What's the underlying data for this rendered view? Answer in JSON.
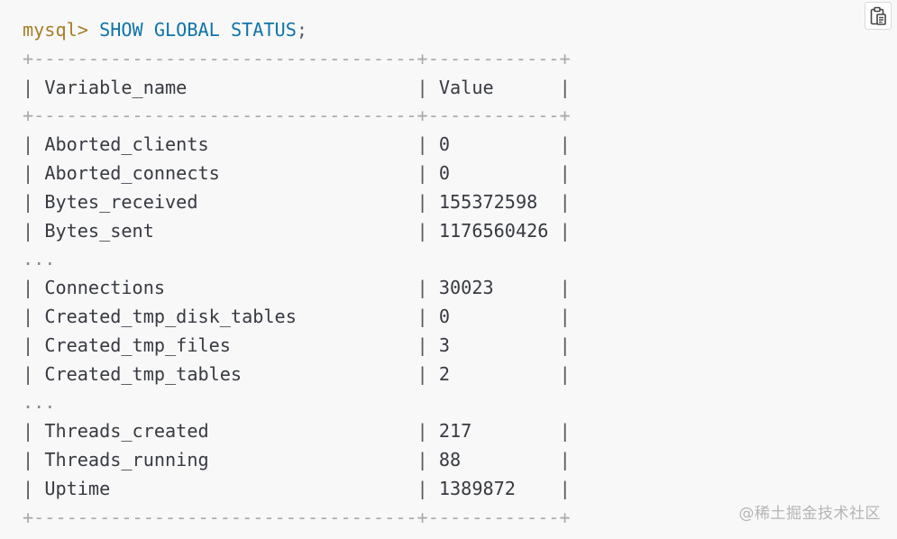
{
  "query": {
    "prompt": "mysql>",
    "command": "SHOW GLOBAL STATUS",
    "terminator": ";"
  },
  "table": {
    "border_line": "+-----------------------------------+------------+",
    "headers": [
      "Variable_name",
      "Value"
    ],
    "rows_group_1": [
      [
        "Aborted_clients",
        "0"
      ],
      [
        "Aborted_connects",
        "0"
      ],
      [
        "Bytes_received",
        "155372598"
      ],
      [
        "Bytes_sent",
        "1176560426"
      ]
    ],
    "ellipsis": "...",
    "rows_group_2": [
      [
        "Connections",
        "30023"
      ],
      [
        "Created_tmp_disk_tables",
        "0"
      ],
      [
        "Created_tmp_files",
        "3"
      ],
      [
        "Created_tmp_tables",
        "2"
      ]
    ],
    "rows_group_3": [
      [
        "Threads_created",
        "217"
      ],
      [
        "Threads_running",
        "88"
      ],
      [
        "Uptime",
        "1389872"
      ]
    ]
  },
  "toolbar": {
    "copy_icon": "clipboard-icon"
  },
  "watermark": {
    "text": "@稀土掘金技术社区"
  },
  "colors": {
    "background": "#f8f8f8",
    "prompt": "#986801",
    "command": "#0f74a8",
    "text": "#383a42",
    "border": "#a9a9a9"
  }
}
